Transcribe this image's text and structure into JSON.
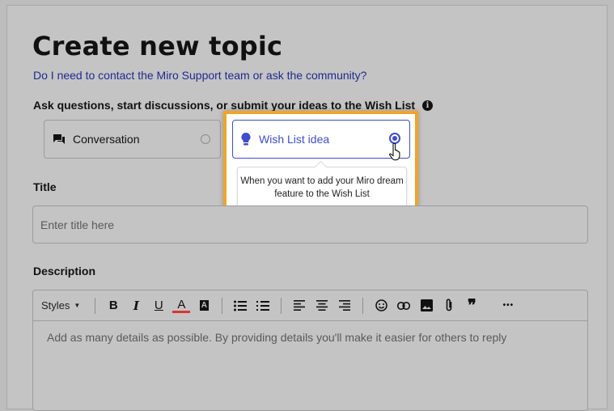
{
  "page": {
    "title": "Create new topic",
    "help_link": "Do I need to contact the Miro Support team or ask the community?",
    "topic_type_label": "Ask questions, start discussions, or submit your ideas to the Wish List",
    "info_icon": "i"
  },
  "topic_types": {
    "conversation": {
      "label": "Conversation",
      "icon": "chat-icon",
      "selected": false
    },
    "wishlist": {
      "label": "Wish List idea",
      "icon": "lightbulb-icon",
      "selected": true
    },
    "tooltip": "When you want to add your Miro dream feature to the Wish List"
  },
  "title_field": {
    "label": "Title",
    "placeholder": "Enter title here"
  },
  "description": {
    "label": "Description",
    "styles_label": "Styles",
    "placeholder": "Add as many details as possible. By providing details you'll make it easier for others to reply",
    "toolbar": {
      "bold": "B",
      "italic": "I",
      "underline": "U",
      "text_color": "A",
      "highlight": "A",
      "quote": "❞",
      "more": "•••"
    }
  },
  "colors": {
    "accent": "#3f4ccc",
    "highlight_border": "#f0a42a",
    "overlay": "#c4c4c4"
  }
}
